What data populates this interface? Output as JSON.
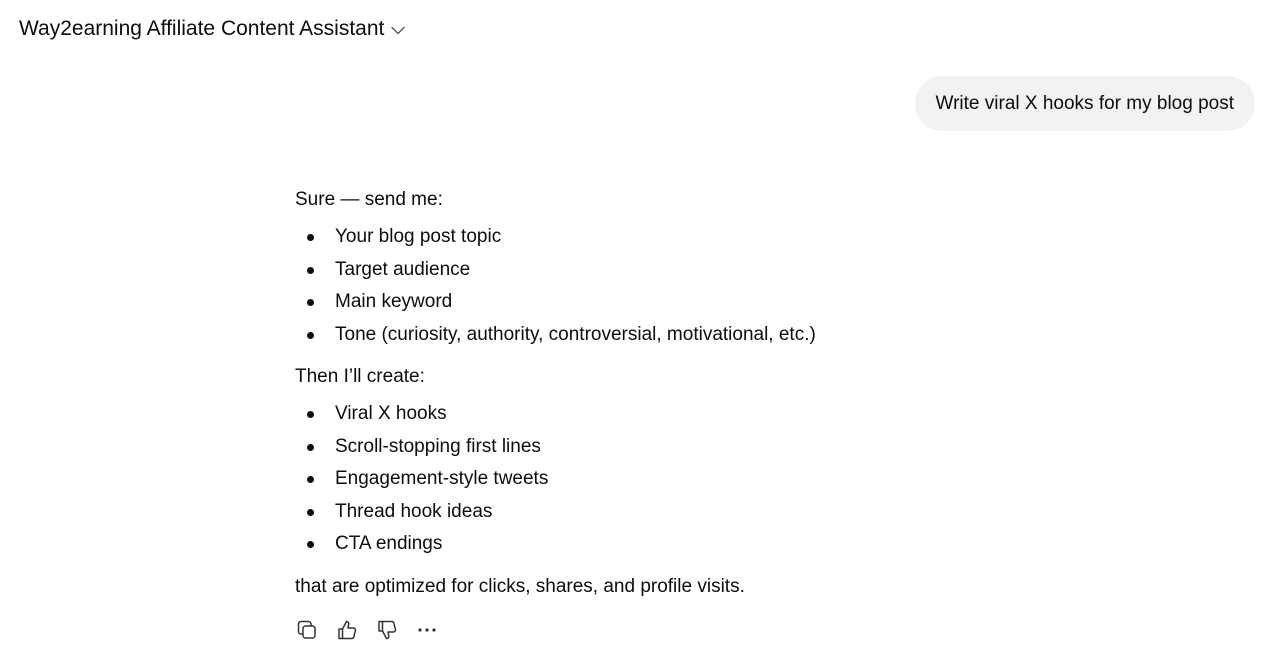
{
  "header": {
    "title": "Way2earning Affiliate Content Assistant",
    "chevron_icon": "chevron-down-icon"
  },
  "user_message": {
    "text": "Write viral X hooks for my blog post"
  },
  "assistant_message": {
    "intro": "Sure — send me:",
    "request_items": [
      "Your blog post topic",
      "Target audience",
      "Main keyword",
      "Tone (curiosity, authority, controversial, motivational, etc.)"
    ],
    "middle": "Then I’ll create:",
    "deliverables": [
      "Viral X hooks",
      "Scroll-stopping first lines",
      "Engagement-style tweets",
      "Thread hook ideas",
      "CTA endings"
    ],
    "outro": "that are optimized for clicks, shares, and profile visits."
  },
  "actions": [
    {
      "icon": "copy-icon"
    },
    {
      "icon": "thumbs-up-icon"
    },
    {
      "icon": "thumbs-down-icon"
    },
    {
      "icon": "more-options-icon"
    }
  ]
}
